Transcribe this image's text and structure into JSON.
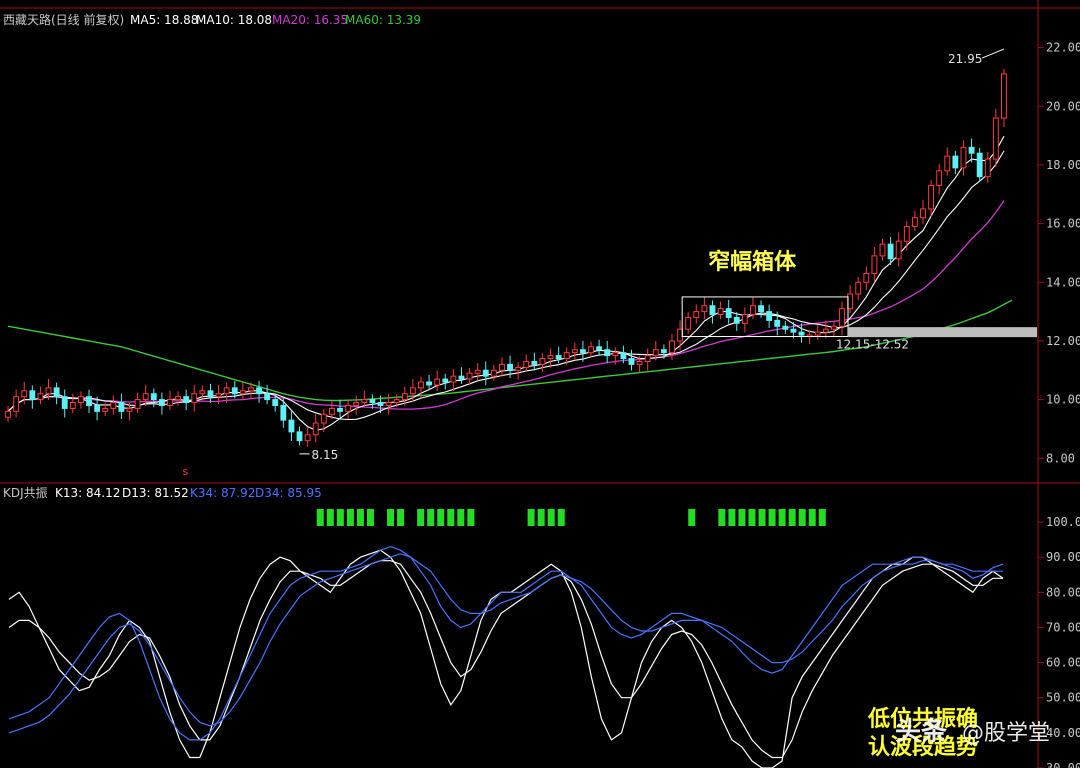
{
  "top_panel": {
    "title": "西藏天路(日线 前复权)",
    "indicators": [
      {
        "label": "MA5: 18.88",
        "color": "#ffffff"
      },
      {
        "label": "MA10: 18.08",
        "color": "#ffffff"
      },
      {
        "label": "MA20: 16.35",
        "color": "#d23cd2"
      },
      {
        "label": "MA60: 13.39",
        "color": "#3cc83c"
      }
    ],
    "box_label": "窄幅箱体",
    "range_label": "12.15-12.52",
    "high_label": "21.95",
    "low_label": "8.15",
    "marker_label": "s"
  },
  "bottom_panel": {
    "title": "KDJ共振",
    "indicators": [
      {
        "label": "K13: 84.12",
        "color": "#ffffff"
      },
      {
        "label": "D13: 81.52",
        "color": "#ffffff"
      },
      {
        "label": "K34: 87.92",
        "color": "#4a74ff"
      },
      {
        "label": "D34: 85.95",
        "color": "#4a74ff"
      }
    ]
  },
  "annotation": {
    "line1": "低位共振确",
    "line2": "认波段趋势"
  },
  "watermark": {
    "brand": "头条",
    "handle": "@股学堂"
  },
  "colors": {
    "up": "#ff3b3b",
    "down": "#5ff0f5",
    "ma5": "#ffffff",
    "ma10": "#ffffff",
    "ma20": "#d23cd2",
    "ma60": "#3cc83c",
    "signal": "#22dd22",
    "label": "#ffff55"
  },
  "chart_data": [
    {
      "type": "candlestick",
      "title": "西藏天路(日线 前复权)",
      "y_ticks": [
        8.0,
        10.0,
        12.0,
        14.0,
        16.0,
        18.0,
        20.0,
        22.0
      ],
      "ylim": [
        7.6,
        22.6
      ],
      "closes": [
        9.6,
        10.1,
        10.3,
        10.0,
        10.2,
        10.4,
        10.1,
        9.7,
        9.9,
        10.1,
        9.8,
        9.6,
        9.7,
        9.9,
        9.6,
        9.7,
        10.0,
        10.2,
        10.0,
        9.8,
        10.0,
        10.1,
        9.9,
        10.2,
        10.3,
        10.1,
        10.2,
        10.4,
        10.2,
        10.3,
        10.4,
        10.2,
        10.0,
        9.8,
        9.3,
        8.9,
        8.6,
        8.8,
        9.2,
        9.5,
        9.7,
        9.6,
        9.8,
        9.9,
        10.0,
        9.9,
        9.8,
        9.9,
        10.0,
        10.2,
        10.4,
        10.6,
        10.5,
        10.7,
        10.6,
        10.8,
        10.7,
        10.9,
        11.0,
        10.8,
        11.0,
        11.2,
        11.0,
        11.1,
        11.3,
        11.2,
        11.4,
        11.5,
        11.4,
        11.6,
        11.7,
        11.6,
        11.8,
        11.7,
        11.5,
        11.6,
        11.4,
        11.2,
        11.3,
        11.5,
        11.7,
        11.6,
        12.0,
        12.4,
        12.8,
        13.0,
        13.2,
        12.9,
        13.1,
        12.8,
        12.6,
        12.9,
        13.2,
        13.0,
        12.7,
        12.5,
        12.4,
        12.3,
        12.2,
        12.2,
        12.3,
        12.4,
        12.5,
        13.1,
        13.6,
        14.0,
        14.3,
        14.9,
        15.3,
        14.8,
        15.4,
        15.9,
        16.2,
        16.5,
        17.3,
        17.8,
        18.3,
        17.9,
        18.6,
        18.4,
        17.6,
        18.2,
        19.6,
        21.1
      ],
      "ma60": [
        12.5,
        12.45,
        12.4,
        12.35,
        12.3,
        12.25,
        12.2,
        12.15,
        12.1,
        12.05,
        12.0,
        11.95,
        11.9,
        11.85,
        11.8,
        11.72,
        11.64,
        11.56,
        11.48,
        11.4,
        11.32,
        11.24,
        11.16,
        11.08,
        11.0,
        10.92,
        10.84,
        10.76,
        10.68,
        10.6,
        10.52,
        10.44,
        10.36,
        10.28,
        10.2,
        10.14,
        10.08,
        10.04,
        10.0,
        9.98,
        9.97,
        9.97,
        9.98,
        9.99,
        10.0,
        10.02,
        10.04,
        10.06,
        10.08,
        10.1,
        10.12,
        10.14,
        10.16,
        10.18,
        10.2,
        10.23,
        10.26,
        10.29,
        10.32,
        10.35,
        10.38,
        10.41,
        10.44,
        10.47,
        10.5,
        10.53,
        10.56,
        10.59,
        10.62,
        10.65,
        10.68,
        10.71,
        10.74,
        10.77,
        10.8,
        10.83,
        10.86,
        10.89,
        10.92,
        10.95,
        10.98,
        11.01,
        11.04,
        11.07,
        11.1,
        11.13,
        11.16,
        11.19,
        11.22,
        11.25,
        11.28,
        11.31,
        11.34,
        11.37,
        11.4,
        11.43,
        11.46,
        11.49,
        11.52,
        11.55,
        11.58,
        11.61,
        11.64,
        11.68,
        11.72,
        11.76,
        11.8,
        11.86,
        11.92,
        11.98,
        12.04,
        12.1,
        12.16,
        12.24,
        12.32,
        12.4,
        12.48,
        12.56,
        12.66,
        12.76,
        12.86,
        12.96,
        13.1,
        13.25,
        13.39
      ],
      "special_marks": {
        "high": 21.95,
        "low": 8.15,
        "box": [
          12.15,
          13.5
        ],
        "range": [
          12.15,
          12.52
        ],
        "zone": 12.3
      }
    },
    {
      "type": "line",
      "title": "KDJ共振",
      "y_ticks": [
        30.0,
        40.0,
        50.0,
        60.0,
        70.0,
        80.0,
        90.0,
        100.0
      ],
      "ylim": [
        30,
        104
      ],
      "series": [
        {
          "name": "K13",
          "values": [
            78,
            80,
            76,
            70,
            64,
            58,
            55,
            52,
            53,
            58,
            62,
            68,
            72,
            70,
            66,
            56,
            46,
            38,
            33,
            33,
            40,
            50,
            60,
            70,
            78,
            84,
            88,
            90,
            89,
            86,
            84,
            82,
            80,
            84,
            88,
            90,
            91,
            92,
            90,
            86,
            80,
            74,
            64,
            54,
            48,
            52,
            62,
            72,
            78,
            80,
            80,
            82,
            84,
            86,
            88,
            86,
            80,
            70,
            56,
            44,
            38,
            40,
            50,
            60,
            66,
            70,
            72,
            70,
            66,
            60,
            52,
            44,
            38,
            36,
            32,
            30,
            30,
            32,
            50,
            56,
            60,
            64,
            68,
            72,
            76,
            80,
            84,
            86,
            88,
            88,
            90,
            90,
            88,
            86,
            84,
            82,
            80,
            84,
            86,
            84
          ]
        },
        {
          "name": "D13",
          "values": [
            70,
            72,
            72,
            70,
            67,
            63,
            60,
            57,
            55,
            56,
            58,
            62,
            66,
            68,
            67,
            62,
            56,
            48,
            42,
            38,
            38,
            42,
            49,
            56,
            64,
            72,
            78,
            83,
            86,
            86,
            85,
            84,
            82,
            82,
            84,
            86,
            88,
            89,
            89,
            88,
            84,
            80,
            74,
            67,
            60,
            56,
            58,
            63,
            69,
            74,
            76,
            78,
            80,
            82,
            84,
            85,
            83,
            78,
            71,
            62,
            54,
            50,
            50,
            54,
            59,
            64,
            68,
            69,
            68,
            65,
            60,
            54,
            48,
            43,
            38,
            35,
            33,
            33,
            38,
            46,
            52,
            57,
            62,
            66,
            70,
            74,
            78,
            82,
            84,
            86,
            87,
            88,
            88,
            87,
            86,
            84,
            82,
            82,
            84,
            84
          ]
        },
        {
          "name": "K34",
          "values": [
            44,
            45,
            46,
            48,
            50,
            54,
            58,
            62,
            66,
            70,
            73,
            74,
            72,
            66,
            58,
            50,
            44,
            40,
            38,
            38,
            40,
            44,
            50,
            56,
            62,
            68,
            74,
            78,
            82,
            84,
            85,
            86,
            86,
            86,
            87,
            88,
            90,
            92,
            93,
            92,
            90,
            86,
            82,
            76,
            72,
            70,
            71,
            74,
            77,
            80,
            80,
            80,
            82,
            84,
            86,
            86,
            84,
            82,
            78,
            74,
            70,
            68,
            67,
            68,
            70,
            72,
            74,
            74,
            73,
            72,
            70,
            68,
            66,
            63,
            60,
            58,
            57,
            58,
            62,
            66,
            70,
            74,
            78,
            82,
            84,
            86,
            88,
            88,
            88,
            89,
            90,
            90,
            89,
            88,
            87,
            86,
            84,
            85,
            87,
            88
          ]
        },
        {
          "name": "D34",
          "values": [
            40,
            41,
            42,
            43,
            45,
            48,
            51,
            55,
            59,
            63,
            67,
            70,
            71,
            69,
            65,
            60,
            55,
            50,
            46,
            43,
            42,
            43,
            46,
            50,
            55,
            60,
            66,
            71,
            75,
            79,
            81,
            83,
            84,
            85,
            86,
            87,
            88,
            89,
            90,
            91,
            90,
            88,
            86,
            82,
            78,
            75,
            74,
            74,
            75,
            77,
            78,
            79,
            80,
            82,
            84,
            85,
            84,
            83,
            81,
            78,
            75,
            72,
            70,
            69,
            69,
            70,
            71,
            72,
            72,
            72,
            71,
            70,
            68,
            66,
            64,
            62,
            60,
            60,
            61,
            63,
            66,
            69,
            72,
            76,
            79,
            82,
            84,
            86,
            87,
            88,
            88,
            89,
            89,
            88,
            88,
            87,
            86,
            86,
            86,
            86
          ]
        }
      ],
      "signal_bars": [
        31,
        32,
        33,
        34,
        35,
        36,
        38,
        39,
        41,
        42,
        43,
        44,
        45,
        46,
        52,
        53,
        54,
        55,
        68,
        71,
        72,
        73,
        74,
        75,
        76,
        77,
        78,
        79,
        80,
        81
      ]
    }
  ]
}
